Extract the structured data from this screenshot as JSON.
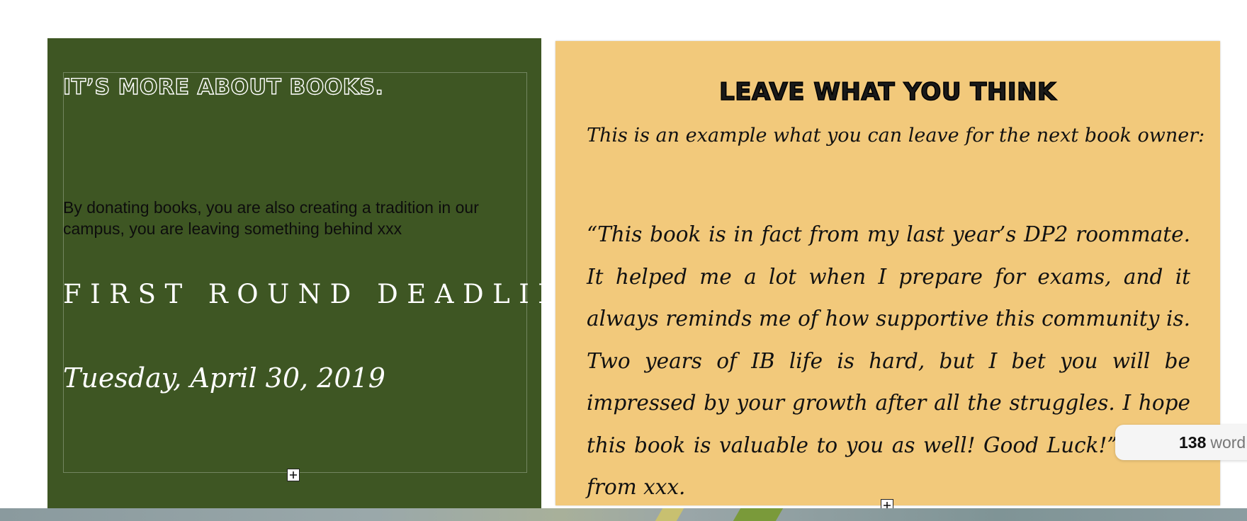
{
  "left_panel": {
    "heading": "IT’S MORE ABOUT BOOKS.",
    "body": "By donating books, you are also creating a tradition in our campus, you are leaving something behind xxx",
    "deadline_label": "FIRST ROUND DEADLINE:",
    "deadline_date": "Tuesday, April 30, 2019",
    "background_color": "#3e5623"
  },
  "right_panel": {
    "heading": "LEAVE WHAT YOU THINK",
    "intro": "This is an example what you can leave for the next book owner:",
    "quote": "“This book is in fact from my last year’s DP2 roommate. It helped me a lot when I prepare for exams, and it always reminds me of how supportive this community is. Two years of IB life is hard, but I bet you will be impressed by your growth after all the struggles. I hope this book is valuable to you as well! Good Luck!”  — xxx from xxx.",
    "background_color": "#f2c97b"
  },
  "word_count": {
    "count": "138",
    "label": "word"
  },
  "icons": {
    "anchor": "plus-square-icon"
  }
}
